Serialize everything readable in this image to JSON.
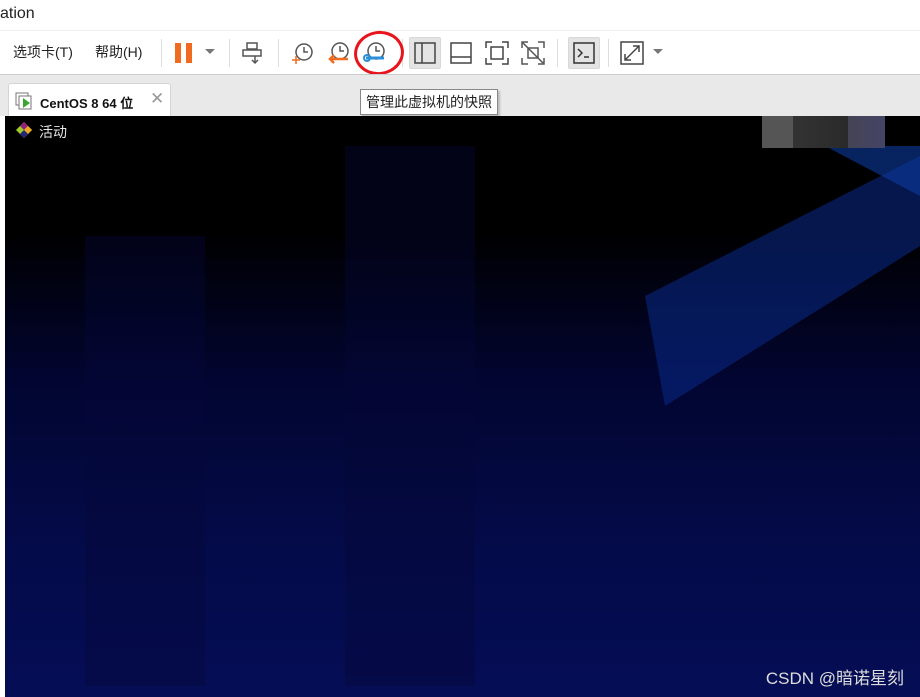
{
  "window": {
    "title_fragment": "ation"
  },
  "menu": [
    "选项卡(T)",
    "帮助(H)"
  ],
  "toolbar": {
    "icons": [
      "pause-icon",
      "send-keys-icon",
      "take-snapshot-icon",
      "revert-snapshot-icon",
      "manage-snapshots-icon",
      "show-library-icon",
      "thumbnail-bar-icon",
      "full-screen-icon",
      "unity-icon",
      "console-view-icon",
      "stretch-icon"
    ],
    "accent_pause": "#f06b20",
    "accent_snapshot": "#2b8fd8"
  },
  "tooltip": "管理此虚拟机的快照",
  "tab": {
    "label": "CentOS 8 64 位"
  },
  "guest": {
    "activities": "活动"
  },
  "watermark": "CSDN @暗诺星刻"
}
